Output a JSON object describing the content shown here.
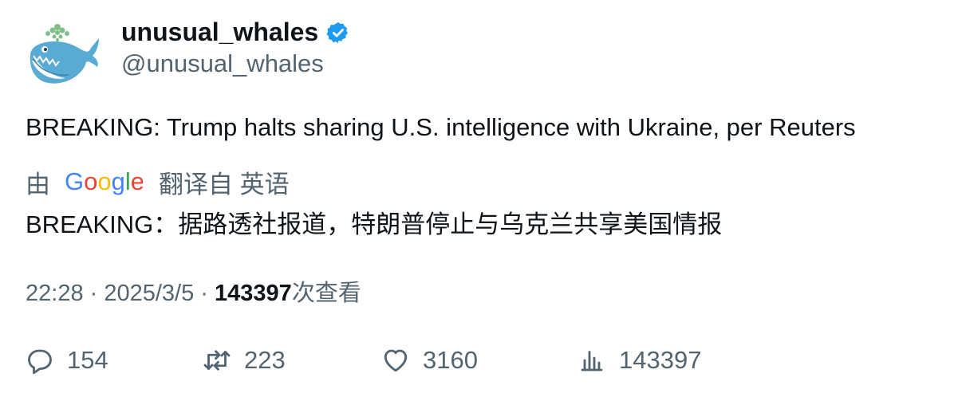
{
  "author": {
    "display_name": "unusual_whales",
    "handle": "@unusual_whales",
    "verified": true,
    "avatar": "whale-logo"
  },
  "tweet": {
    "text": "BREAKING: Trump halts sharing U.S. intelligence with Ukraine, per Reuters"
  },
  "translation": {
    "by_label": "由",
    "provider": "Google",
    "source_label": "翻译自 英语",
    "translated_text": "BREAKING：据路透社报道，特朗普停止与乌克兰共享美国情报"
  },
  "meta": {
    "time": "22:28",
    "separator": " · ",
    "date": "2025/3/5",
    "views": "143397",
    "views_label": "次查看"
  },
  "actions": {
    "replies": "154",
    "retweets": "223",
    "likes": "3160",
    "views": "143397"
  },
  "colors": {
    "text_primary": "#0f1419",
    "text_secondary": "#536471",
    "verified_blue": "#1d9bf0"
  },
  "icons": [
    "verified-badge-icon",
    "reply-icon",
    "retweet-icon",
    "like-icon",
    "views-icon"
  ]
}
